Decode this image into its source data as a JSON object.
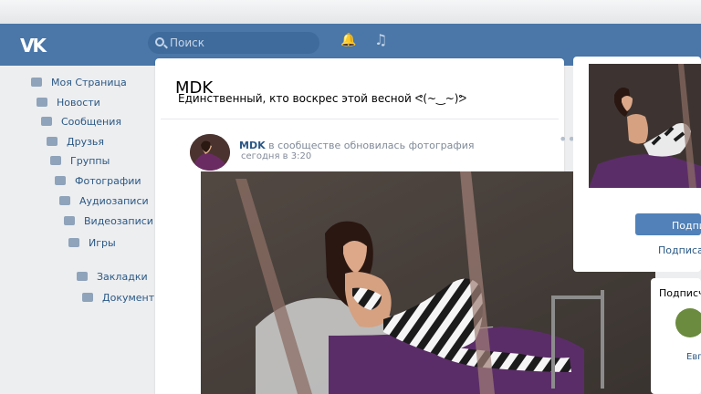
{
  "header": {
    "logo": "VK",
    "search_placeholder": "Поиск",
    "icons": [
      "bell-icon",
      "music-icon"
    ]
  },
  "sidebar": {
    "items": [
      {
        "label": "Моя Страница",
        "icon": "home-icon"
      },
      {
        "label": "Новости",
        "icon": "news-icon"
      },
      {
        "label": "Сообщения",
        "icon": "messages-icon"
      },
      {
        "label": "Друзья",
        "icon": "friend-icon"
      },
      {
        "label": "Группы",
        "icon": "groups-icon"
      },
      {
        "label": "Фотографии",
        "icon": "camera-icon"
      },
      {
        "label": "Аудиозаписи",
        "icon": "music-icon"
      },
      {
        "label": "Видеозаписи",
        "icon": "video-icon"
      },
      {
        "label": "Игры",
        "icon": "games-icon"
      },
      {
        "label": "Закладки",
        "icon": "star-icon"
      },
      {
        "label": "Документы",
        "icon": "document-icon"
      }
    ]
  },
  "post": {
    "title": "MDK",
    "subtitle": "Единственный, кто воскрес этой весной ᕙ(~‿~)ᕗ",
    "author": "MDK",
    "action": "в сообществе обновилась фотография",
    "time": "сегодня в 3:20",
    "menu": "•••"
  },
  "right": {
    "button": "Подпис",
    "link": "Подписан",
    "subscriptions_title": "Подписч",
    "first_name": "Евг"
  },
  "colors": {
    "header": "#4a76a8",
    "link": "#2a5885",
    "button": "#5181b8",
    "background": "#edeef0"
  }
}
